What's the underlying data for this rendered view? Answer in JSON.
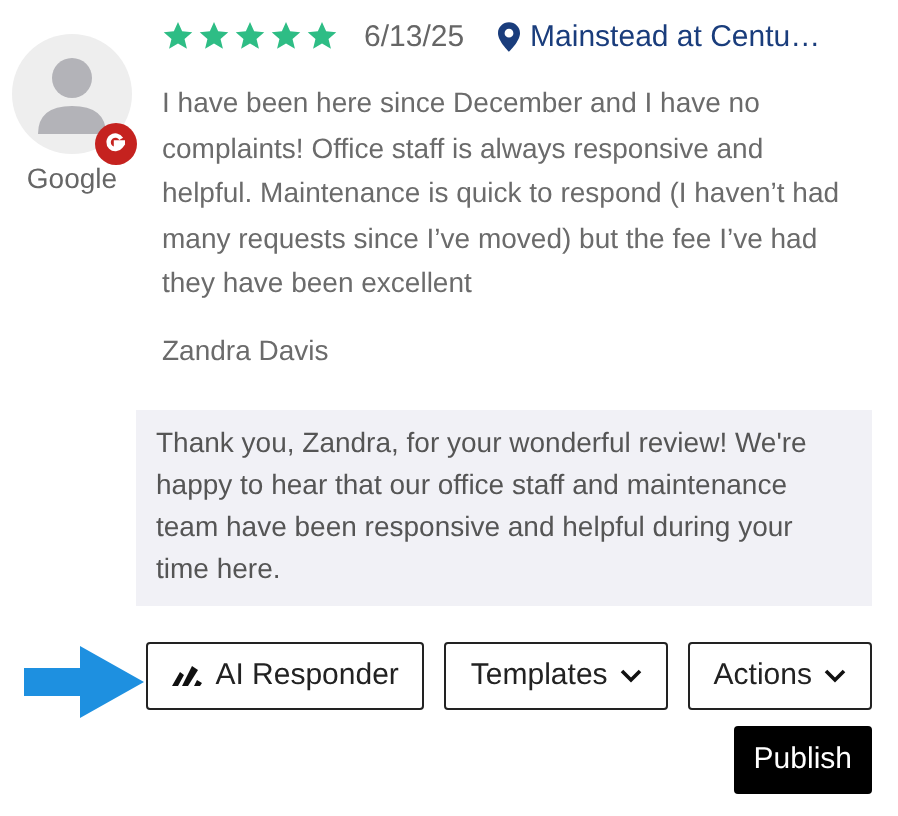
{
  "review": {
    "source": "Google",
    "stars": 5,
    "date": "6/13/25",
    "location": "Mainstead at Centu…",
    "text": "I have been here since December and I have no complaints! Office staff is always responsive and helpful. Maintenance is quick to respond (I haven’t had many requests since I’ve moved) but the fee I’ve had they have been excellent",
    "author": "Zandra Davis"
  },
  "reply": {
    "text": "Thank you, Zandra, for your wonderful review! We're happy to hear that our office staff and maintenance team have been responsive and helpful during your time here."
  },
  "buttons": [
    {
      "kind": "ai",
      "label": "AI Responder"
    },
    {
      "kind": "dropdown",
      "label": "Templates"
    },
    {
      "kind": "dropdown",
      "label": "Actions"
    }
  ],
  "publish": {
    "label": "Publish"
  }
}
